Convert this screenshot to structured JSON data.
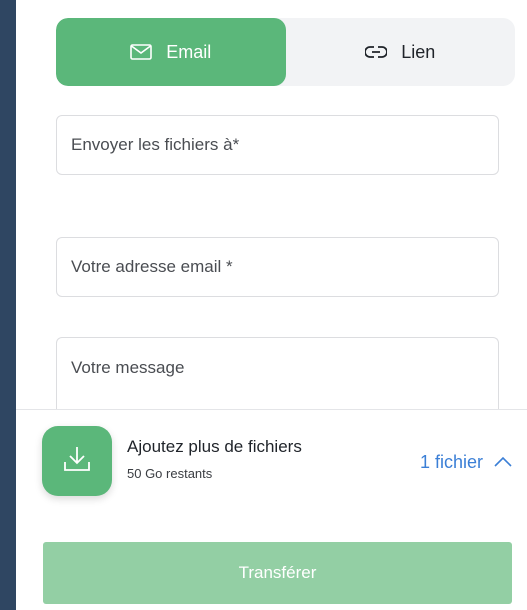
{
  "tabs": {
    "email_label": "Email",
    "link_label": "Lien",
    "active": "email"
  },
  "form": {
    "recipients_placeholder": "Envoyer les fichiers à*",
    "sender_placeholder": "Votre adresse email *",
    "message_placeholder": "Votre message"
  },
  "upload": {
    "title": "Ajoutez plus de fichiers",
    "remaining": "50 Go restants",
    "file_count": "1 fichier"
  },
  "actions": {
    "submit_label": "Transférer"
  },
  "colors": {
    "accent": "#5bb77a",
    "submit_disabled": "#93cfa4",
    "link": "#3b7fd6",
    "background": "#2f4662"
  }
}
